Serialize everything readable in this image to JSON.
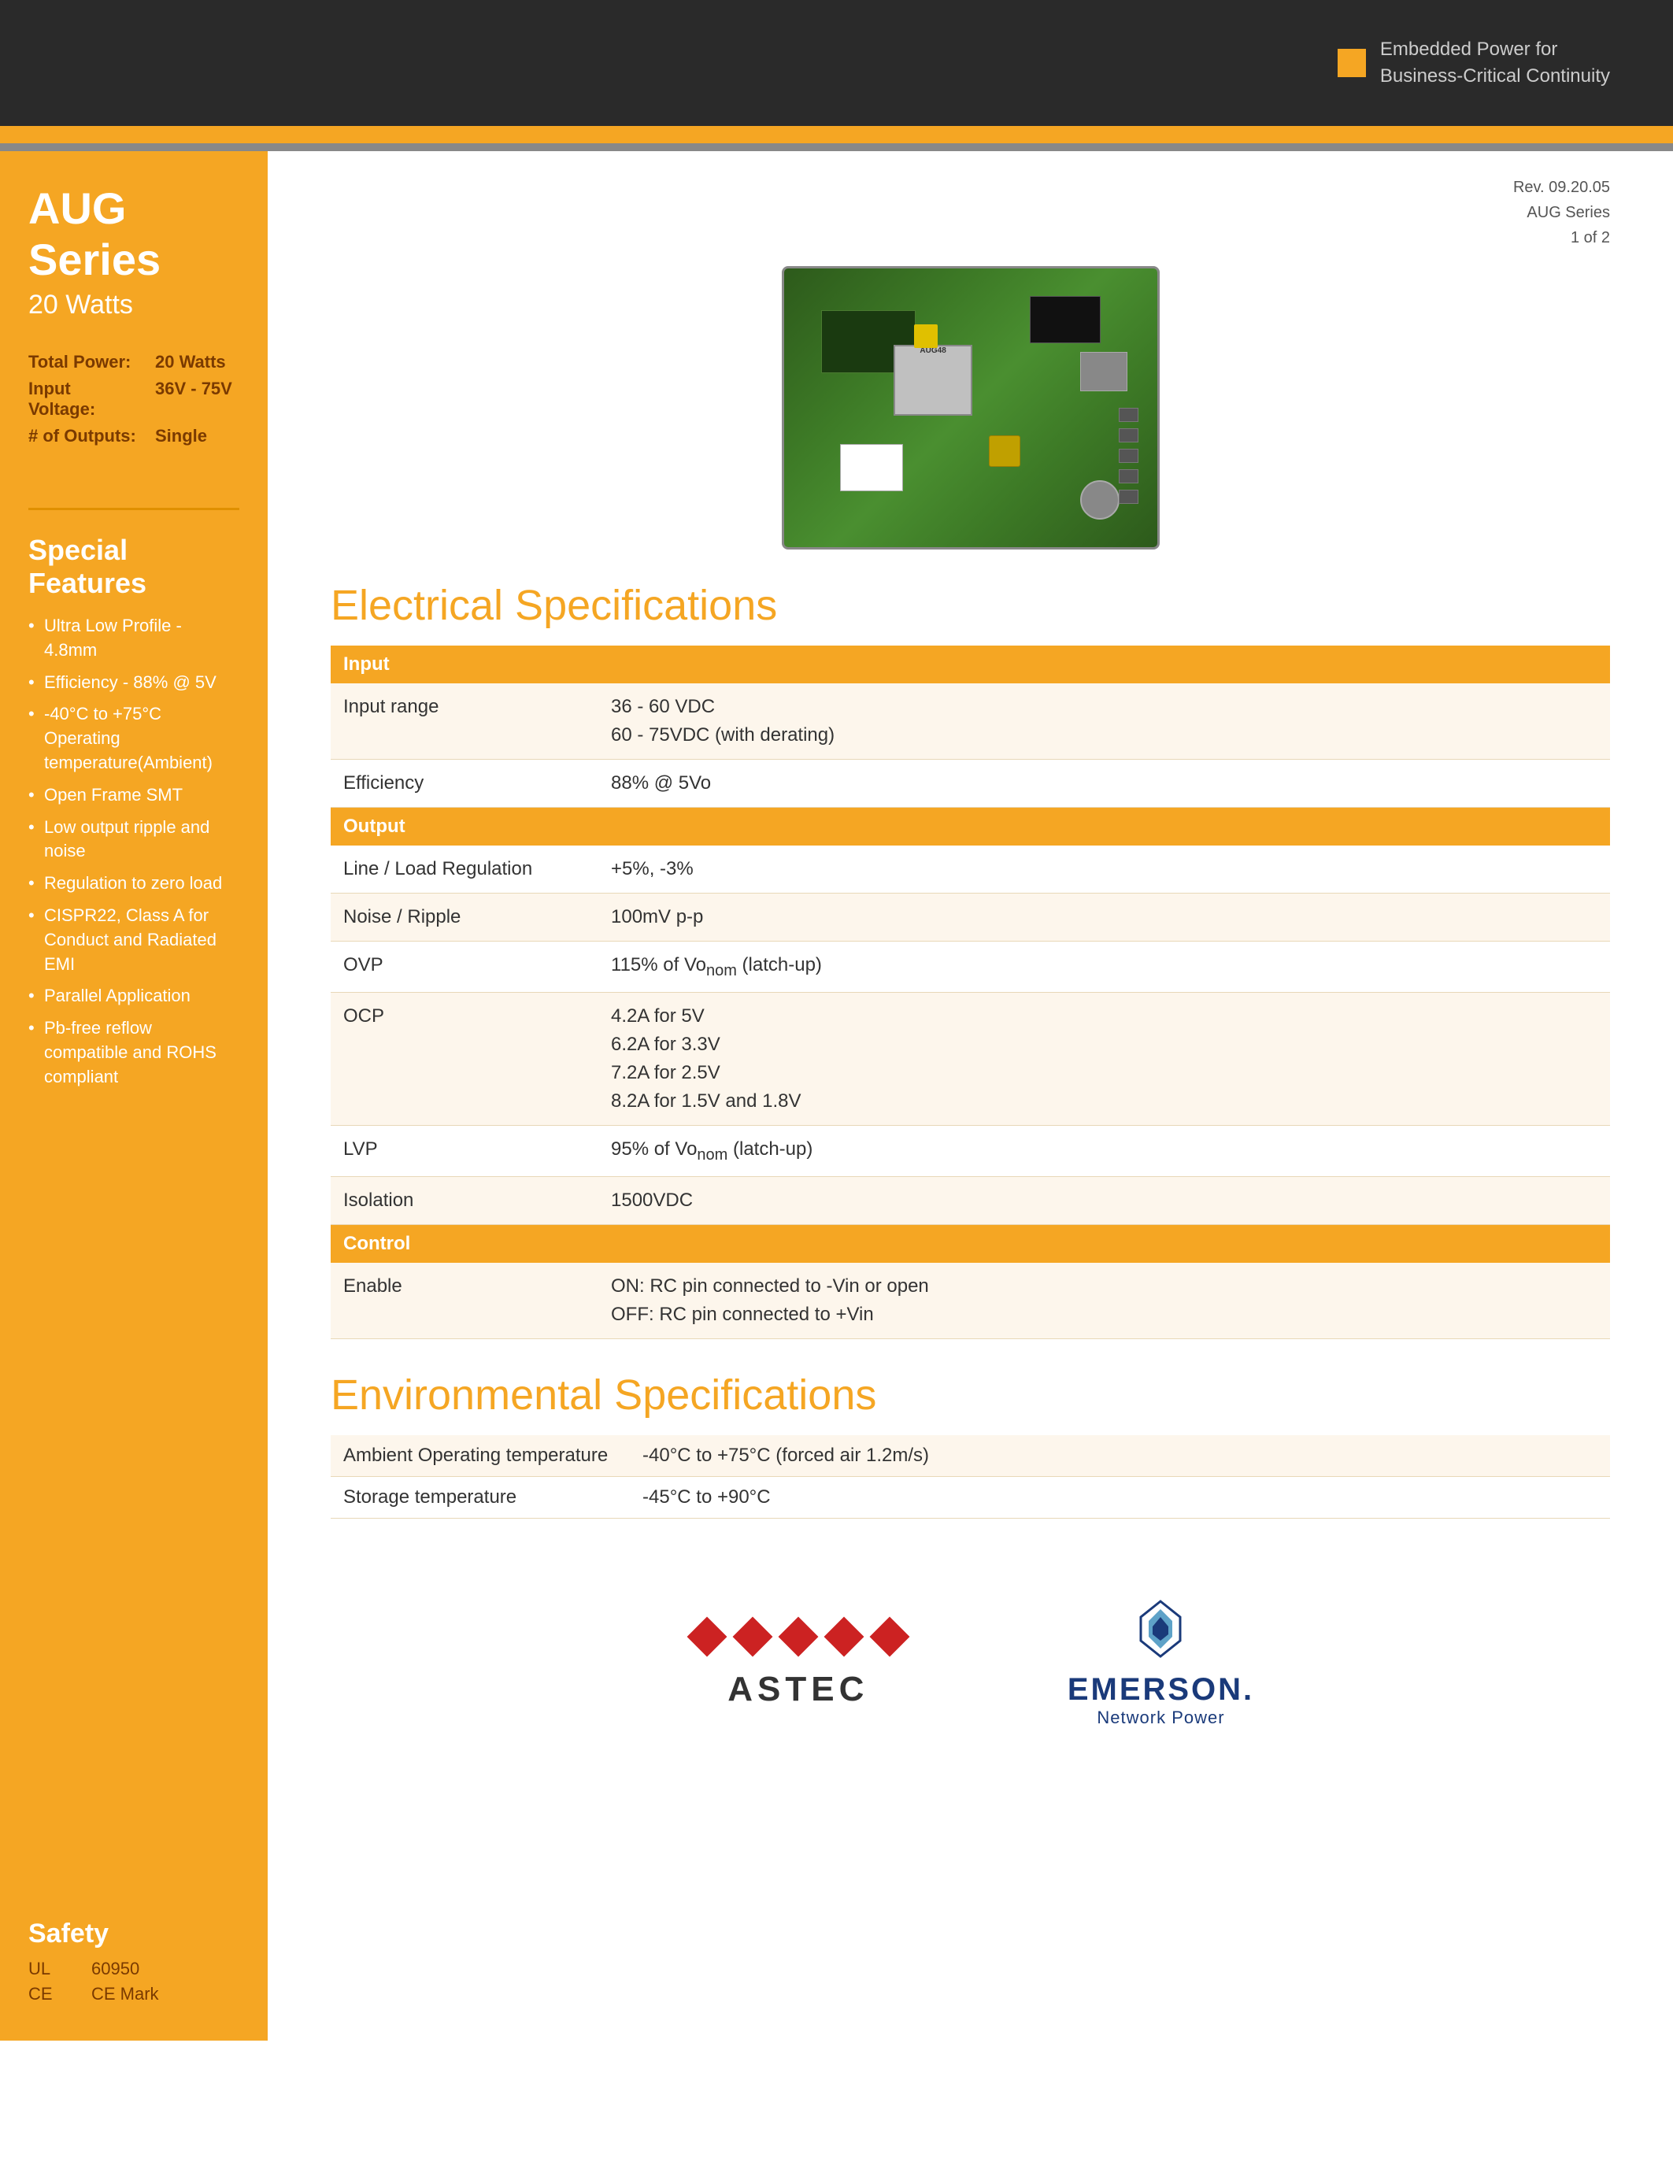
{
  "header": {
    "tagline_line1": "Embedded Power for",
    "tagline_line2": "Business-Critical Continuity"
  },
  "rev_info": {
    "line1": "Rev. 09.20.05",
    "line2": "AUG Series",
    "line3": "1 of 2"
  },
  "sidebar": {
    "series_title": "AUG Series",
    "series_subtitle": "20 Watts",
    "specs": [
      {
        "label": "Total Power:",
        "value": "20 Watts"
      },
      {
        "label": "Input Voltage:",
        "value": "36V - 75V"
      },
      {
        "label": "# of Outputs:",
        "value": "Single"
      }
    ],
    "features_title": "Special Features",
    "features": [
      "Ultra Low Profile - 4.8mm",
      "Efficiency - 88% @ 5V",
      "-40°C to +75°C Operating temperature(Ambient)",
      "Open Frame SMT",
      "Low output ripple and noise",
      "Regulation to zero load",
      "CISPR22, Class A for Conduct and Radiated EMI",
      "Parallel Application",
      "Pb-free reflow compatible and ROHS compliant"
    ],
    "safety_title": "Safety",
    "safety": [
      {
        "label": "UL",
        "value": "60950"
      },
      {
        "label": "CE",
        "value": "CE Mark"
      }
    ]
  },
  "electrical_specs": {
    "section_title": "Electrical Specifications",
    "input_header": "Input",
    "input_rows": [
      {
        "label": "Input range",
        "value_line1": "36 - 60 VDC",
        "value_line2": "60 - 75VDC (with derating)"
      },
      {
        "label": "Efficiency",
        "value_line1": "88% @ 5Vo",
        "value_line2": ""
      }
    ],
    "output_header": "Output",
    "output_rows": [
      {
        "label": "Line / Load Regulation",
        "value": "+5%, -3%"
      },
      {
        "label": "Noise / Ripple",
        "value": "100mV p-p"
      },
      {
        "label": "OVP",
        "value": "115% of Voₙₒₘ (latch-up)"
      },
      {
        "label": "OCP",
        "value_line1": "4.2A for 5V",
        "value_line2": "6.2A for 3.3V",
        "value_line3": "7.2A for 2.5V",
        "value_line4": "8.2A for 1.5V and 1.8V"
      },
      {
        "label": "LVP",
        "value": "95% of Voₙₒₘ (latch-up)"
      },
      {
        "label": "Isolation",
        "value": "1500VDC"
      }
    ],
    "control_header": "Control",
    "control_rows": [
      {
        "label": "Enable",
        "value_line1": "ON: RC pin connected to -Vin or open",
        "value_line2": "OFF: RC pin connected to +Vin"
      }
    ]
  },
  "environmental_specs": {
    "section_title": "Environmental Specifications",
    "rows": [
      {
        "label": "Ambient Operating temperature",
        "value": "-40°C to +75°C (forced air 1.2m/s)"
      },
      {
        "label": "Storage temperature",
        "value": "-45°C to +90°C"
      }
    ]
  },
  "footer": {
    "astec_brand": "ASTEC",
    "emerson_name": "EMERSON.",
    "emerson_sub": "Network Power"
  }
}
